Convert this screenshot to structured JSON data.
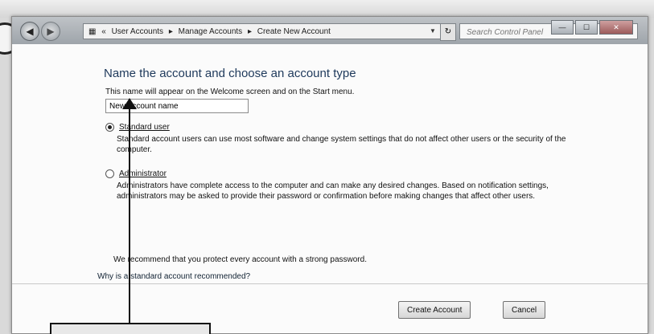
{
  "breadcrumb": {
    "items": [
      "User Accounts",
      "Manage Accounts",
      "Create New Account"
    ],
    "separator": "▸"
  },
  "search": {
    "placeholder": "Search Control Panel"
  },
  "page": {
    "title": "Name the account and choose an account type",
    "hint": "This name will appear on the Welcome screen and on the Start menu.",
    "name_field": {
      "value": "New account name"
    },
    "options": [
      {
        "label": "Standard user",
        "selected": true,
        "description": "Standard account users can use most software and change system settings that do not affect other users or the security of the computer."
      },
      {
        "label": "Administrator",
        "selected": false,
        "description": "Administrators have complete access to the computer and can make any desired changes. Based on notification settings, administrators may be asked to provide their password or confirmation before making changes that affect other users."
      }
    ],
    "recommendation": "We recommend that you protect every account with a strong password.",
    "help_link": "Why is a standard account recommended?"
  },
  "buttons": {
    "create": "Create Account",
    "cancel": "Cancel"
  },
  "icons": {
    "back": "back-arrow-icon",
    "forward": "forward-arrow-icon",
    "control_panel": "control-panel-icon",
    "refresh": "refresh-icon",
    "search": "search-icon"
  },
  "colors": {
    "title": "#1e395b",
    "titlebar": "#9ea4aa"
  }
}
